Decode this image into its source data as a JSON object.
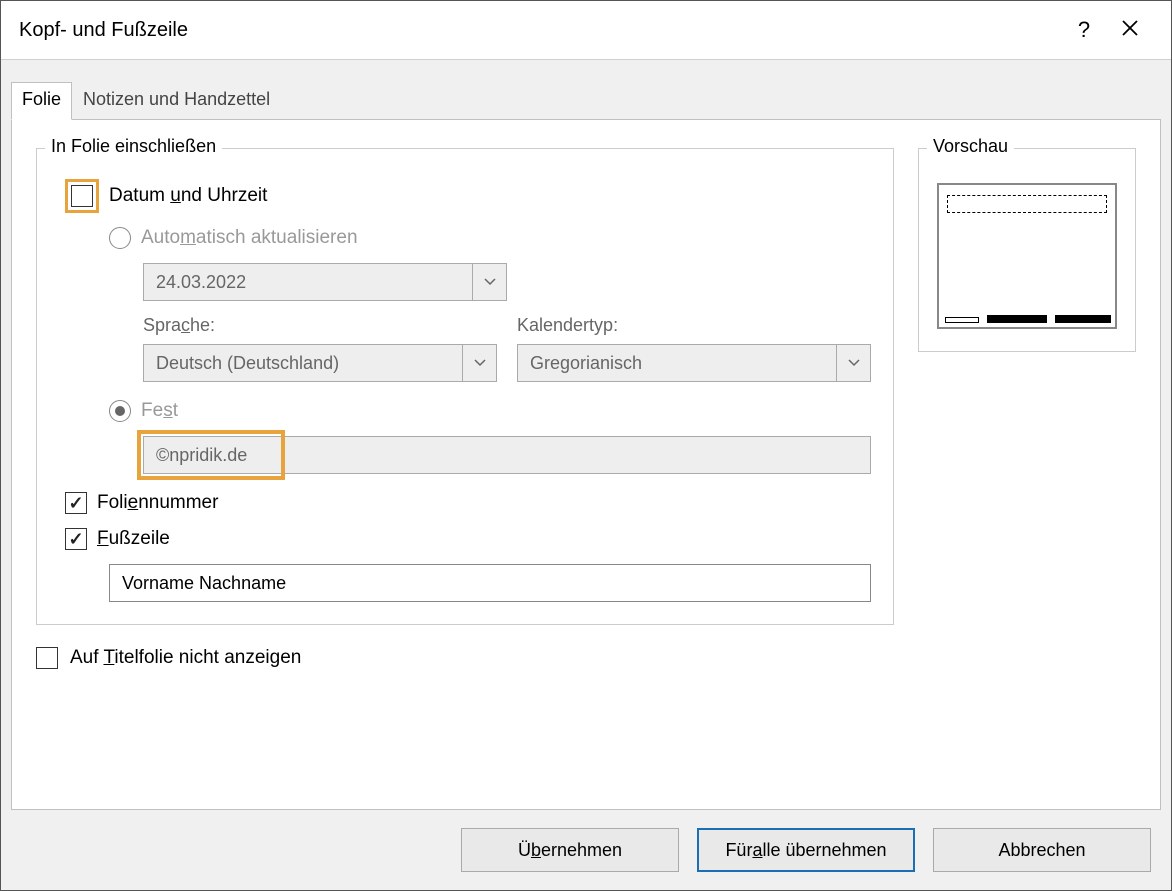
{
  "title": "Kopf- und Fußzeile",
  "tabs": {
    "slide": "Folie",
    "notes": "Notizen und Handzettel"
  },
  "include_legend": "In Folie einschließen",
  "preview_legend": "Vorschau",
  "datetime": {
    "label_pre": "Datum ",
    "label_u": "u",
    "label_post": "nd Uhrzeit",
    "auto_pre": "Auto",
    "auto_u": "m",
    "auto_post": "atisch aktualisieren",
    "date_value": "24.03.2022",
    "lang_label_pre": "Spra",
    "lang_label_u": "c",
    "lang_label_post": "he:",
    "lang_value": "Deutsch (Deutschland)",
    "cal_label": "Kalendertyp:",
    "cal_value": "Gregorianisch",
    "fixed_pre": "Fe",
    "fixed_u": "s",
    "fixed_post": "t",
    "fixed_value": "©npridik.de"
  },
  "slidenum_pre": "Foli",
  "slidenum_u": "e",
  "slidenum_post": "nnummer",
  "footer_u": "F",
  "footer_post": "ußzeile",
  "footer_value": "Vorname Nachname",
  "hide_title_pre": "Auf ",
  "hide_title_u": "T",
  "hide_title_post": "itelfolie nicht anzeigen",
  "buttons": {
    "apply_pre": "Ü",
    "apply_u": "b",
    "apply_post": "ernehmen",
    "applyall_pre": "Für ",
    "applyall_u": "a",
    "applyall_post": "lle übernehmen",
    "cancel": "Abbrechen"
  }
}
